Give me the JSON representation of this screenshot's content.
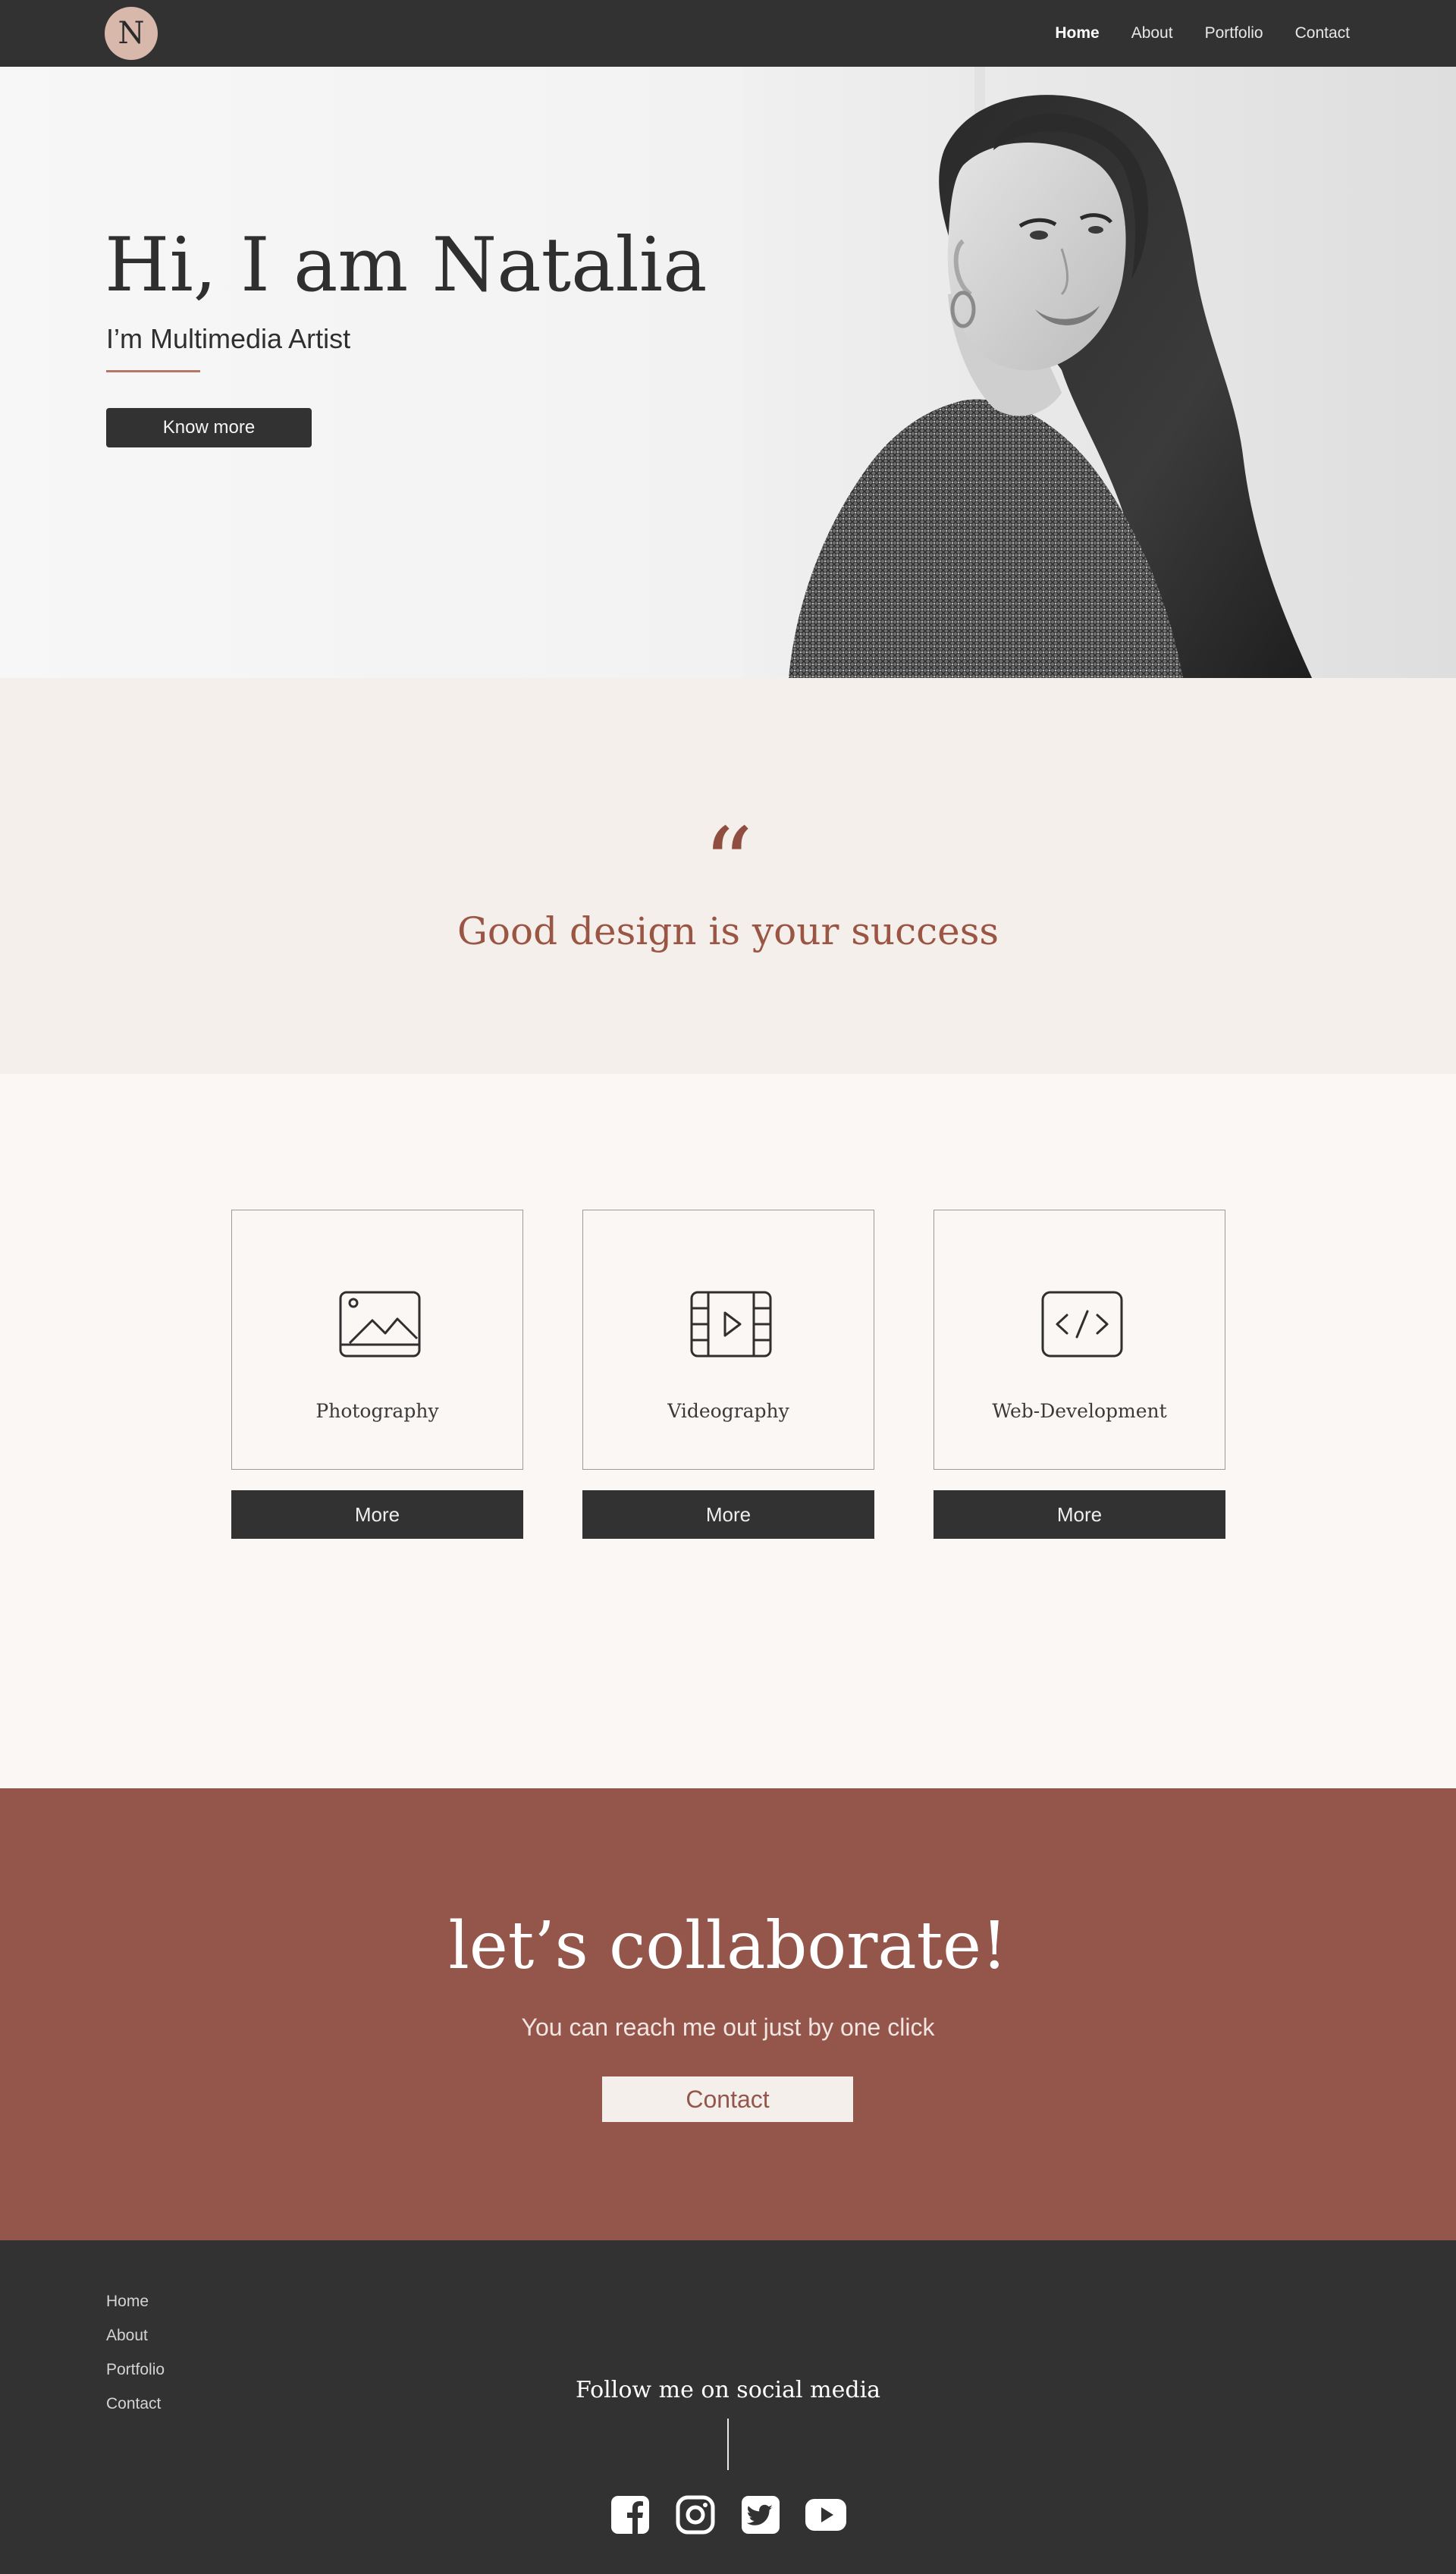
{
  "nav": {
    "logo_letter": "N",
    "links": [
      "Home",
      "About",
      "Portfolio",
      "Contact"
    ],
    "active": "Home"
  },
  "hero": {
    "title": "Hi, I am Natalia",
    "subtitle": "I’m Multimedia Artist",
    "button": "Know more",
    "accent_color": "#b57866"
  },
  "quote": {
    "mark": "“",
    "text": "Good design is your success",
    "color": "#9b5544"
  },
  "services": {
    "cards": [
      {
        "label": "Photography",
        "icon": "image-icon",
        "button": "More"
      },
      {
        "label": "Videography",
        "icon": "film-icon",
        "button": "More"
      },
      {
        "label": "Web-Development",
        "icon": "code-icon",
        "button": "More"
      }
    ]
  },
  "collab": {
    "title": "let’s collaborate!",
    "subtitle": "You can reach me out just by one click",
    "button": "Contact",
    "bg_color": "#94564a"
  },
  "footer": {
    "links": [
      "Home",
      "About",
      "Portfolio",
      "Contact"
    ],
    "follow": "Follow me on social media",
    "social": [
      "facebook-icon",
      "instagram-icon",
      "twitter-icon",
      "youtube-icon"
    ]
  }
}
